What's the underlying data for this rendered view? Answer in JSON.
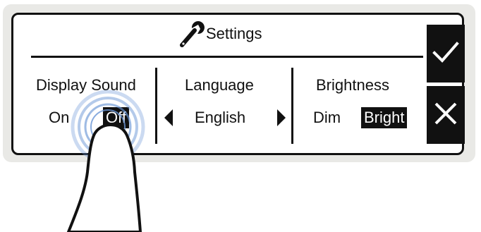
{
  "panel": {
    "title": "Settings",
    "title_icon": "wrench-icon"
  },
  "settings": [
    {
      "label": "Display Sound",
      "options": [
        "On",
        "Off"
      ],
      "selected": "Off"
    },
    {
      "label": "Language",
      "value": "English",
      "prev_icon": "arrow-left-icon",
      "next_icon": "arrow-right-icon"
    },
    {
      "label": "Brightness",
      "options": [
        "Dim",
        "Bright"
      ],
      "selected": "Bright"
    }
  ],
  "actions": {
    "confirm_icon": "checkmark-icon",
    "cancel_icon": "close-icon"
  },
  "overlay": {
    "gesture": "finger-tap",
    "ripple_color": "#6a96d6"
  }
}
